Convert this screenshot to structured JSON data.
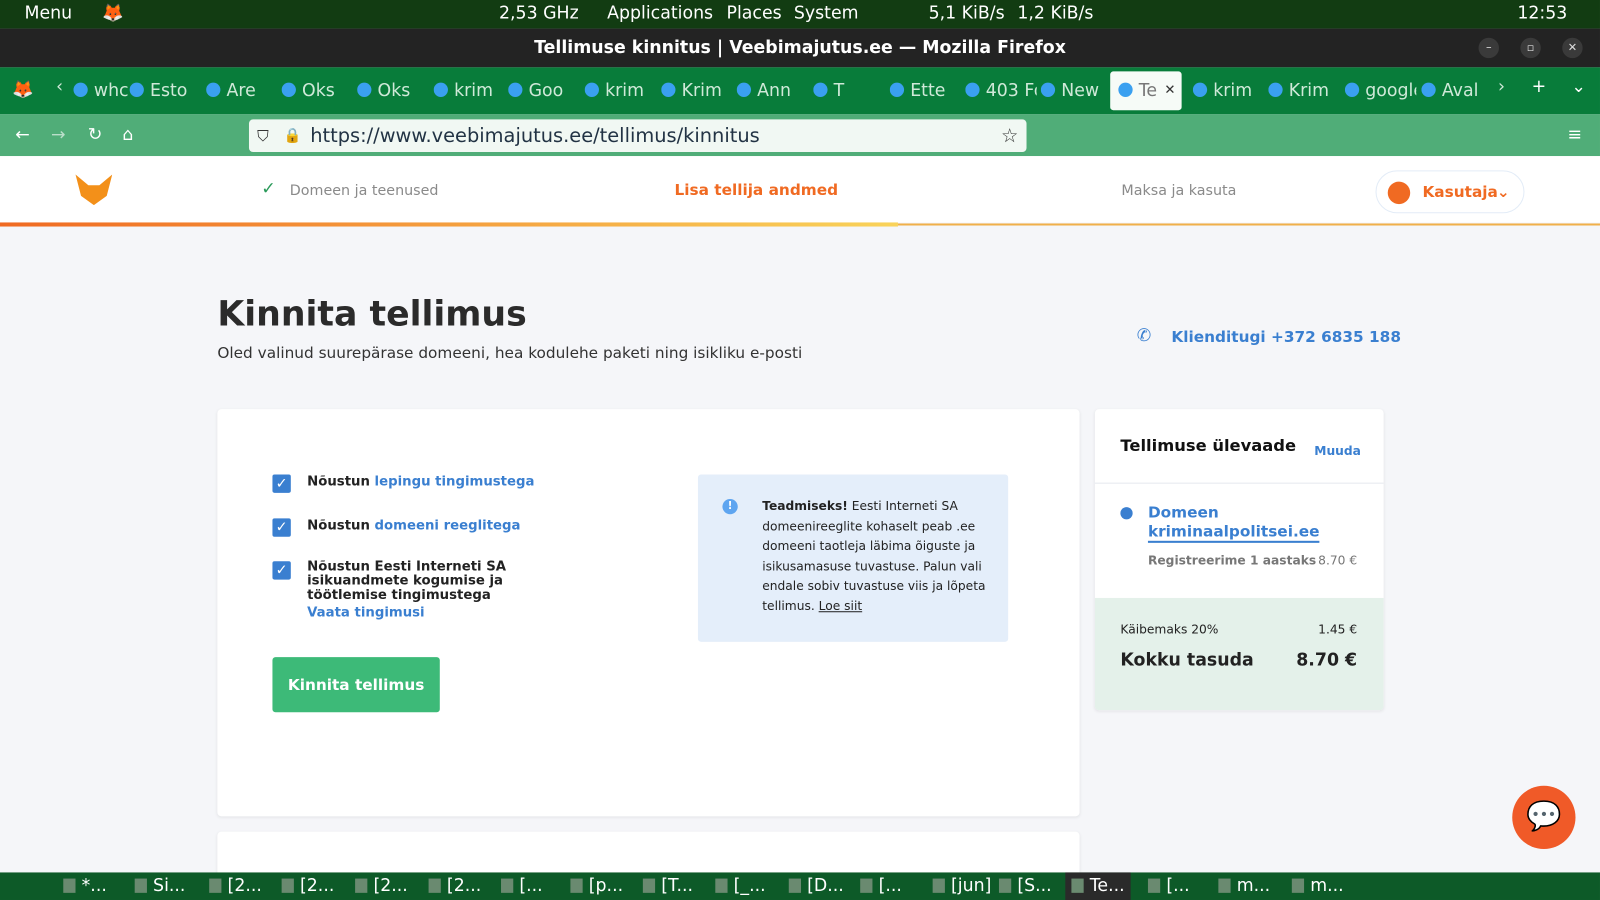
{
  "system_panel": {
    "menu": "Menu",
    "cpu": "2,53 GHz",
    "applications": "Applications",
    "places": "Places",
    "system": "System",
    "net_down": "5,1 KiB/s",
    "net_up": "1,2 KiB/s",
    "clock": "12:53"
  },
  "window": {
    "title": "Tellimuse kinnitus | Veebimajutus.ee — Mozilla Firefox"
  },
  "tabs": [
    "whc",
    "Esto",
    "Are",
    "Oks",
    "Oks",
    "krim",
    "Goo",
    "krim",
    "Krim",
    "Ann",
    "T",
    "Ette",
    "403 Fo",
    "New",
    "Te",
    "krim",
    "Krim",
    "google",
    "Aval"
  ],
  "browser": {
    "url": "https://www.veebimajutus.ee/tellimus/kinnitus"
  },
  "header": {
    "steps": [
      "Domeen ja teenused",
      "Lisa tellija andmed",
      "Maksa ja kasuta"
    ],
    "account": "Kasutaja"
  },
  "page": {
    "title": "Kinnita tellimus",
    "subtitle": "Oled valinud suurepärase domeeni, hea kodulehe paketi ning isikliku e-posti",
    "phone": "Klienditugi +372 6835 188"
  },
  "terms": [
    {
      "prefix": "Nõustun",
      "link": "lepingu tingimustega",
      "checked": true
    },
    {
      "prefix": "Nõustun",
      "link": "domeeni reeglitega",
      "checked": true
    },
    {
      "prefix": "Nõustun Eesti Interneti SA isikuandmete kogumise ja töötlemise tingimustega",
      "link": "Vaata tingimusi",
      "checked": true
    }
  ],
  "info": {
    "bold": "Teadmiseks!",
    "text": "Eesti Interneti SA domeenireeglite kohaselt peab .ee domeeni taotleja läbima õiguste ja isikusamasuse tuvastuse. Palun vali endale sobiv tuvastuse viis ja lõpeta tellimus.",
    "link": "Loe siit"
  },
  "confirm_button": "Kinnita tellimus",
  "summary": {
    "title": "Tellimuse ülevaade",
    "edit": "Muuda",
    "item_type": "Domeen",
    "item_name": "kriminaalpolitsei.ee",
    "item_desc": "Registreerime 1 aastaks",
    "item_price": "8.70 €",
    "vat_label": "Käibemaks 20%",
    "vat": "1.45 €",
    "total_label": "Kokku tasuda",
    "total": "8.70 €"
  },
  "taskbar": [
    "*...",
    "Si...",
    "[2...",
    "[2...",
    "[2...",
    "[2...",
    "[...",
    "[p...",
    "[T...",
    "[_...",
    "[D...",
    "[...",
    "[jun]",
    "[S...",
    "Te...",
    "[...",
    "m...",
    "m..."
  ],
  "colors": {
    "accent_orange": "#f06a22",
    "link_blue": "#3a7fd0",
    "button_green": "#3dba78"
  }
}
